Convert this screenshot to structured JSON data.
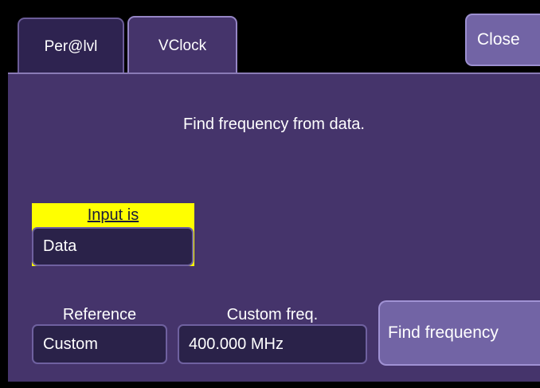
{
  "tabs": [
    {
      "label": "Per@lvl",
      "active": false
    },
    {
      "label": "VClock",
      "active": true
    }
  ],
  "close_label": "Close",
  "info_text": "Find frequency from data.",
  "input": {
    "label": "Input is",
    "value": "Data"
  },
  "reference": {
    "label": "Reference",
    "value": "Custom"
  },
  "custom_freq": {
    "label": "Custom freq.",
    "value": "400.000 MHz"
  },
  "find_frequency_label": "Find frequency",
  "colors": {
    "panel": "#45346b",
    "highlight": "#ffff00",
    "button": "#7264a5",
    "field": "#2a2249"
  }
}
